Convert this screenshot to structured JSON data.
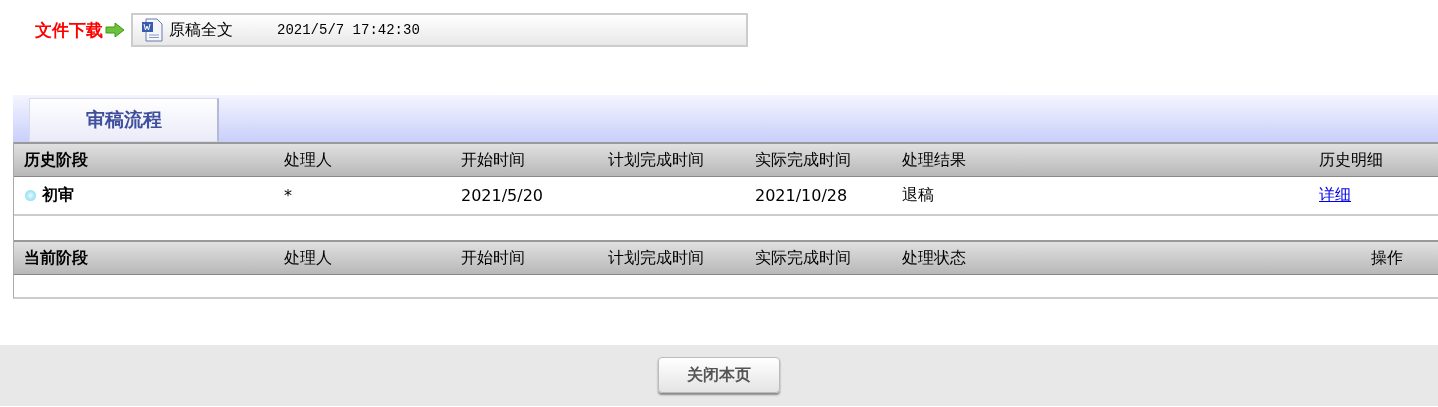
{
  "download": {
    "label": "文件下载",
    "file_name": "原稿全文",
    "time": "2021/5/7 17:42:30"
  },
  "tabs": [
    {
      "label": "审稿流程",
      "selected": true
    }
  ],
  "history": {
    "columns": [
      "历史阶段",
      "处理人",
      "开始时间",
      "计划完成时间",
      "实际完成时间",
      "处理结果",
      "历史明细"
    ],
    "rows": [
      {
        "cells": [
          "初审",
          "*",
          "2021/5/20",
          "",
          "2021/10/28",
          "退稿"
        ],
        "link": "详细"
      }
    ]
  },
  "current": {
    "columns": [
      "当前阶段",
      "处理人",
      "开始时间",
      "计划完成时间",
      "实际完成时间",
      "处理状态",
      "操作"
    ]
  },
  "close_button": "关闭本页"
}
